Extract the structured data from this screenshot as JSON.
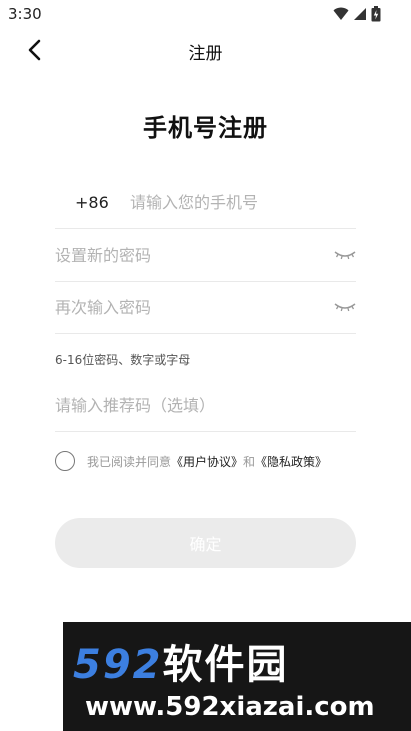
{
  "status_bar": {
    "time": "3:30"
  },
  "nav": {
    "title": "注册"
  },
  "heading": "手机号注册",
  "phone": {
    "country_code": "+86",
    "placeholder": "请输入您的手机号"
  },
  "password": {
    "placeholder": "设置新的密码"
  },
  "confirm_password": {
    "placeholder": "再次输入密码"
  },
  "password_hint": "6-16位密码、数字或字母",
  "referral": {
    "placeholder": "请输入推荐码（选填）"
  },
  "agreement": {
    "prefix": "我已阅读并同意",
    "user_agreement": "《用户协议》",
    "and": "和",
    "privacy_policy": "《隐私政策》"
  },
  "confirm_button": "确定",
  "watermark": {
    "brand_number": "592",
    "brand_text": "软件园",
    "url": "www.592xiazai.com"
  }
}
